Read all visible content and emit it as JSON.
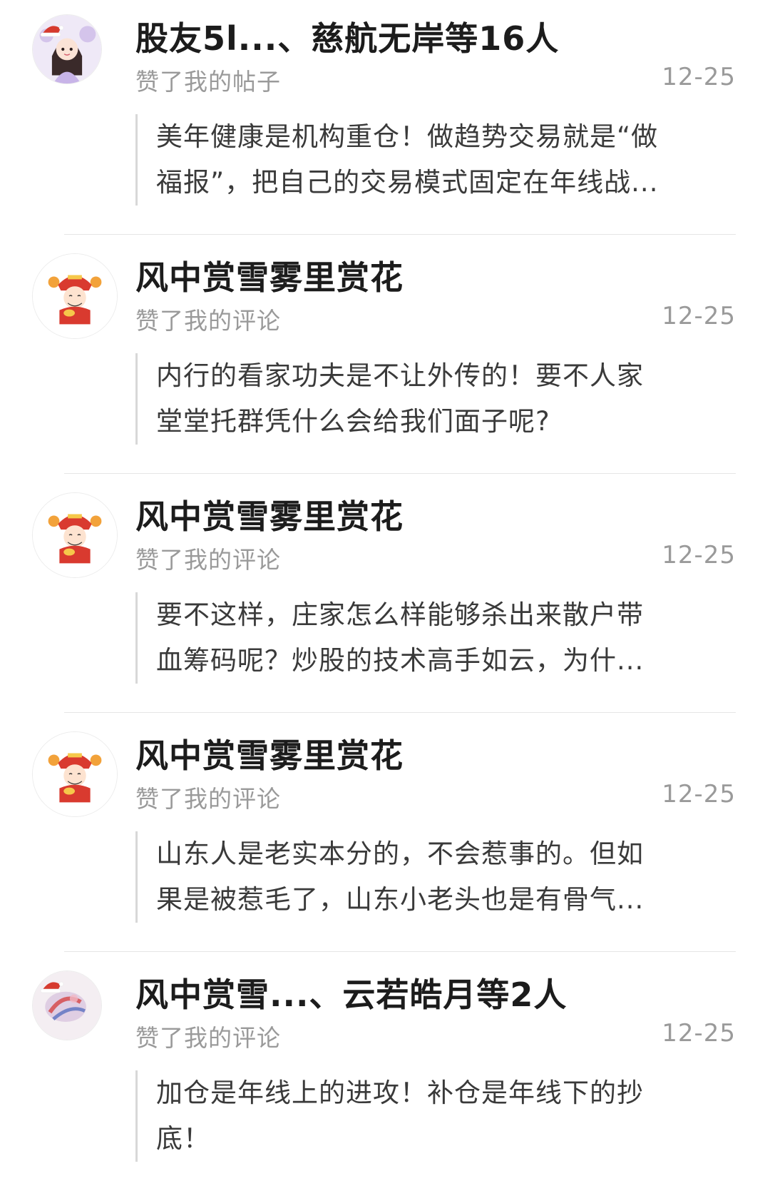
{
  "notifications": [
    {
      "title": "股友5l...、慈航无岸等16人",
      "action": "赞了我的帖子",
      "date": "12-25",
      "quote_line1": "美年健康是机构重仓！做趋势交易就是“做",
      "quote_line2": "福报”，把自己的交易模式固定在年线战...",
      "avatar_icon": "girl-portrait-avatar"
    },
    {
      "title": "风中赏雪雾里赏花",
      "action": "赞了我的评论",
      "date": "12-25",
      "quote_line1": "内行的看家功夫是不让外传的！要不人家",
      "quote_line2": "堂堂托群凭什么会给我们面子呢?",
      "avatar_icon": "fortune-god-avatar"
    },
    {
      "title": "风中赏雪雾里赏花",
      "action": "赞了我的评论",
      "date": "12-25",
      "quote_line1": "要不这样，庄家怎么样能够杀出来散户带",
      "quote_line2": "血筹码呢？炒股的技术高手如云，为什...",
      "avatar_icon": "fortune-god-avatar"
    },
    {
      "title": "风中赏雪雾里赏花",
      "action": "赞了我的评论",
      "date": "12-25",
      "quote_line1": "山东人是老实本分的，不会惹事的。但如",
      "quote_line2": "果是被惹毛了，山东小老头也是有骨气...",
      "avatar_icon": "fortune-god-avatar"
    },
    {
      "title": "风中赏雪...、云若皓月等2人",
      "action": "赞了我的评论",
      "date": "12-25",
      "quote_line1": "加仓是年线上的进攻！补仓是年线下的抄",
      "quote_line2": "底！",
      "avatar_icon": "blurred-avatar"
    }
  ],
  "colors": {
    "title": "#1c1c1c",
    "meta": "#9a9a9a",
    "quote_text": "#3a3a3a",
    "quote_bar": "#d8d8d8",
    "divider": "#e6e6e6"
  }
}
